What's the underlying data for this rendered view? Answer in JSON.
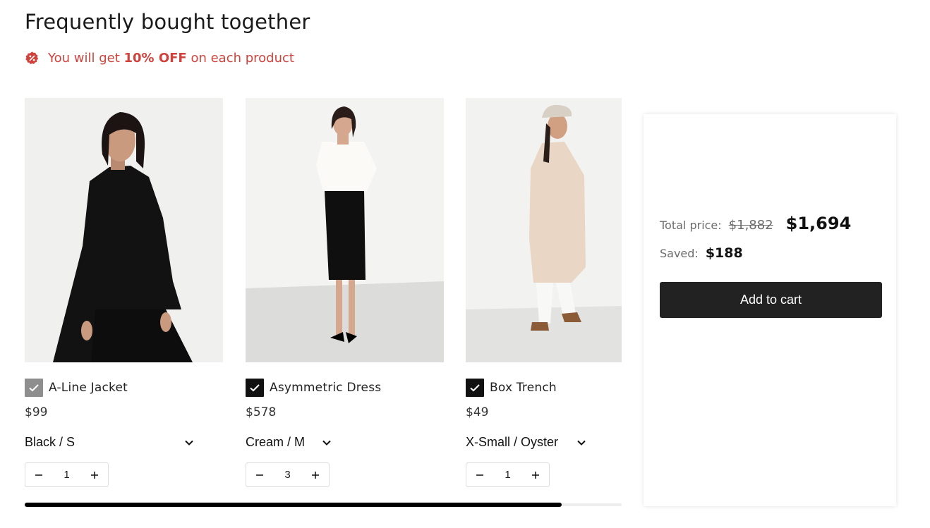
{
  "section": {
    "title": "Frequently bought together",
    "promo": {
      "prefix": "You will get ",
      "highlight": "10% OFF",
      "suffix": " on each product",
      "icon": "discount-badge-icon",
      "color": "#d0433d"
    }
  },
  "products": [
    {
      "name": "A-Line Jacket",
      "price": "$99",
      "variant": "Black / S",
      "qty": "1",
      "checked": true,
      "checkbox_state": "disabled"
    },
    {
      "name": "Asymmetric Dress",
      "price": "$578",
      "variant": "Cream / M",
      "qty": "3",
      "checked": true,
      "checkbox_state": "enabled"
    },
    {
      "name": "Box Trench",
      "price": "$49",
      "variant": "X-Small / Oyster",
      "qty": "1",
      "checked": true,
      "checkbox_state": "enabled"
    }
  ],
  "summary": {
    "total_label": "Total price:",
    "original_total": "$1,882",
    "final_total": "$1,694",
    "saved_label": "Saved:",
    "saved_value": "$188",
    "add_to_cart": "Add to cart"
  },
  "scroll": {
    "progress": 0.9
  },
  "colors": {
    "accent": "#d0433d",
    "button": "#222222",
    "checkbox_checked": "#111111",
    "checkbox_disabled": "#8e8e8e"
  }
}
